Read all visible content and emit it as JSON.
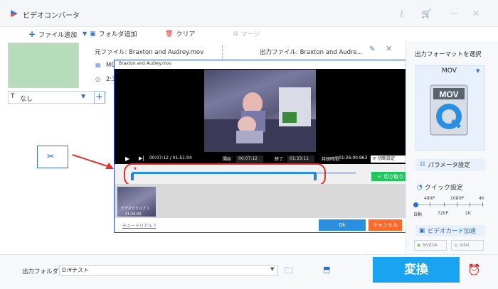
{
  "app": {
    "title": "ビデオコンバータ"
  },
  "titlebar_icons": [
    "key-icon",
    "cart-icon",
    "minimize-icon",
    "close-icon"
  ],
  "toolbar": {
    "add_file": "ファイル追加",
    "add_folder": "フォルダ追加",
    "clear": "クリア",
    "merge": "マージ"
  },
  "file": {
    "source": "元ファイル: Braxton and Audrey.mov",
    "output": "出力ファイル: Braxton and Audre...",
    "format_short": "MOV",
    "duration_short": "2:3"
  },
  "subtitle": {
    "value": "なし"
  },
  "dialog": {
    "title": "Braxton and Audrey.mov",
    "current_time": "00:07:12 / 01:51:04",
    "start_label": "開始",
    "start_value": "00:07:12",
    "end_label": "終了",
    "end_value": "01:33:11",
    "span_label": "持続時間:",
    "span_value": "01:26:00.963",
    "split_setting": "切断設定",
    "cut_button": "切り取り",
    "clip_label": "ビデオクリップ 1",
    "clip_duration": "01:26:00",
    "tutorial_link": "チュートリアル ?",
    "ok": "Ok",
    "cancel": "キャンセル"
  },
  "right_panel": {
    "heading": "出力フォーマットを選択",
    "format": "MOV",
    "params": "パラメータ設定",
    "quick": "クイック設定",
    "res_top": [
      "480P",
      "1080P",
      "4K"
    ],
    "res_bottom": [
      "自動",
      "720P",
      "2K"
    ],
    "gpu": "ビデオカード加速",
    "nvidia": "NVIDIA",
    "intel": "Intel"
  },
  "bottom": {
    "output_folder_label": "出力フォルダ：",
    "output_folder_value": "D:¥テスト",
    "convert": "変換"
  },
  "colors": {
    "accent": "#1aa3f0",
    "highlight": "#e03030",
    "cut_green": "#22c55e",
    "cancel_orange": "#ff6a2a"
  }
}
